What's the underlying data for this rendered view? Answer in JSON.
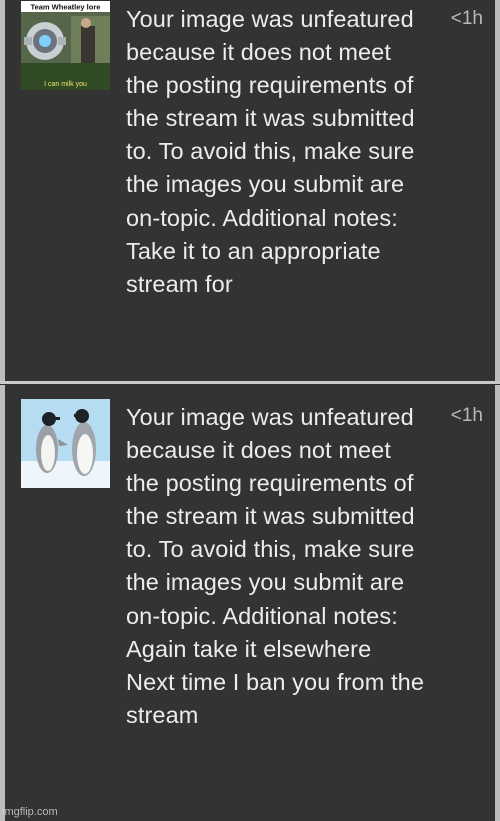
{
  "notifications": [
    {
      "thumb_caption_top": "Team Wheatley lore",
      "thumb_caption_bottom": "I can milk you",
      "message": "Your image was unfeatured because it does not meet the posting requirements of the stream it was submitted to. To avoid this, make sure the images you submit are on-topic. Additional notes: Take it to an appropriate stream for",
      "time": "<1h"
    },
    {
      "message": "Your image was unfeatured because it does not meet the posting requirements of the stream it was submitted to. To avoid this, make sure the images you submit are on-topic. Additional notes: Again take it elsewhere Next time I ban you from the stream",
      "time": "<1h"
    }
  ],
  "watermark": "imgflip.com"
}
